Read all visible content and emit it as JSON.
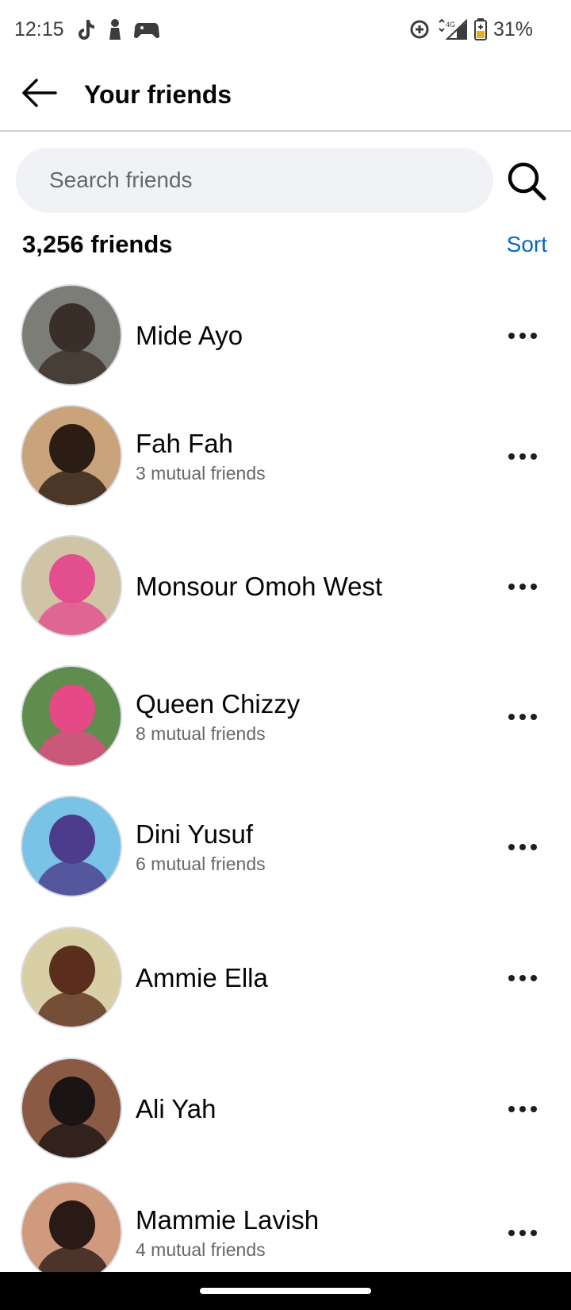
{
  "status_bar": {
    "time": "12:15",
    "network": "4G",
    "battery": "31%",
    "left_icons": [
      "tiktok-icon",
      "person-icon",
      "gamepad-icon"
    ],
    "right_icons": [
      "data-saver-icon",
      "signal-icon",
      "battery-icon"
    ]
  },
  "header": {
    "title": "Your friends",
    "back_icon": "arrow-left-icon"
  },
  "search": {
    "placeholder": "Search friends",
    "value": "",
    "icon": "search-icon"
  },
  "friends": {
    "count_label": "3,256 friends",
    "sort_label": "Sort",
    "items": [
      {
        "name": "Mide Ayo",
        "mutual": "",
        "avatar_bg": "#7d7d78",
        "avatar_fg": "#3a2e28"
      },
      {
        "name": "Fah Fah",
        "mutual": "3 mutual friends",
        "avatar_bg": "#c9a37a",
        "avatar_fg": "#2b1c14"
      },
      {
        "name": "Monsour Omoh West",
        "mutual": "",
        "avatar_bg": "#cfc5a6",
        "avatar_fg": "#e24e8e"
      },
      {
        "name": "Queen Chizzy",
        "mutual": "8 mutual friends",
        "avatar_bg": "#5f8d4e",
        "avatar_fg": "#e64a86"
      },
      {
        "name": "Dini Yusuf",
        "mutual": "6 mutual friends",
        "avatar_bg": "#78c3e6",
        "avatar_fg": "#4b3c8c"
      },
      {
        "name": "Ammie Ella",
        "mutual": "",
        "avatar_bg": "#d9cfa6",
        "avatar_fg": "#5a2d1c"
      },
      {
        "name": "Ali Yah",
        "mutual": "",
        "avatar_bg": "#8a5a44",
        "avatar_fg": "#1a1414"
      },
      {
        "name": "Mammie Lavish",
        "mutual": "4 mutual friends",
        "avatar_bg": "#d09a7e",
        "avatar_fg": "#2a1a16"
      }
    ]
  },
  "more_icon": "more-horizontal-icon",
  "colors": {
    "accent": "#0a66c2",
    "search_bg": "#f0f2f5",
    "secondary_text": "#65676b"
  }
}
